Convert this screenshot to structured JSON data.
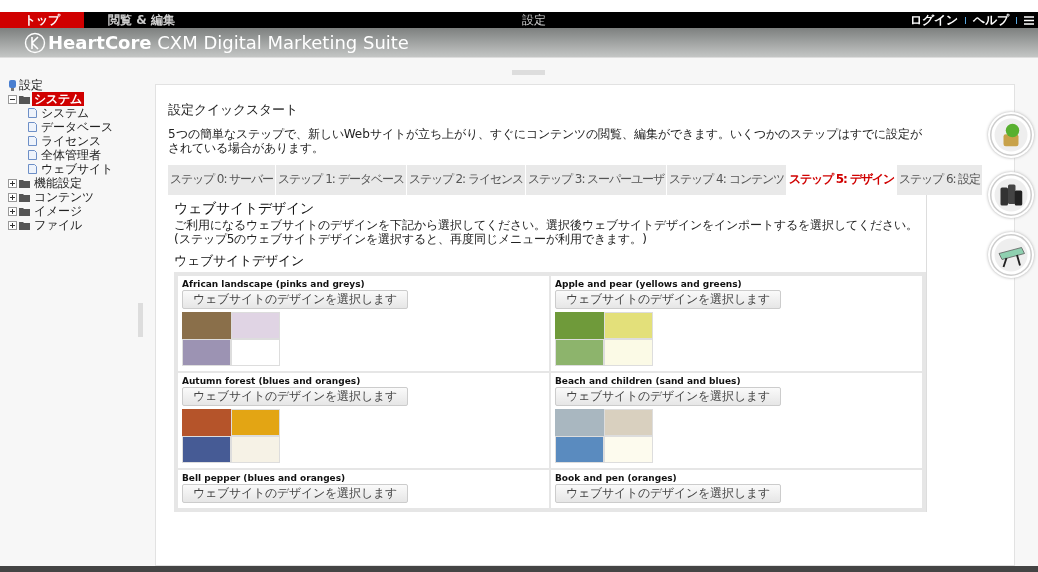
{
  "top_nav": {
    "items": [
      {
        "label": "トップ",
        "selected": true
      },
      {
        "label": "閲覧 & 編集",
        "selected": false
      }
    ],
    "center_title": "設定",
    "links": [
      "ログイン",
      "ヘルプ"
    ]
  },
  "header": {
    "brand_bold": "HeartCore",
    "brand_rest": "CXM Digital Marketing Suite"
  },
  "tree": {
    "label": "設定",
    "children": [
      {
        "label": "システム",
        "expanded": true,
        "selected": true,
        "children": [
          {
            "label": "システム"
          },
          {
            "label": "データベース"
          },
          {
            "label": "ライセンス"
          },
          {
            "label": "全体管理者"
          },
          {
            "label": "ウェブサイト"
          }
        ]
      },
      {
        "label": "機能設定",
        "expanded": false,
        "selected": false
      },
      {
        "label": "コンテンツ",
        "expanded": false,
        "selected": false
      },
      {
        "label": "イメージ",
        "expanded": false,
        "selected": false
      },
      {
        "label": "ファイル",
        "expanded": false,
        "selected": false
      }
    ]
  },
  "page": {
    "title": "設定クイックスタート",
    "intro": "5つの簡単なステップで、新しいWebサイトが立ち上がり、すぐにコンテンツの閲覧、編集ができます。いくつかのステップはすでに設定がされている場合があります。"
  },
  "tabs": [
    {
      "label": "ステップ 0: サーバー",
      "selected": false
    },
    {
      "label": "ステップ 1: データベース",
      "selected": false
    },
    {
      "label": "ステップ 2: ライセンス",
      "selected": false
    },
    {
      "label": "ステップ 3: スーパーユーザ",
      "selected": false
    },
    {
      "label": "ステップ 4: コンテンツ",
      "selected": false
    },
    {
      "label": "ステップ 5: デザイン",
      "selected": true
    },
    {
      "label": "ステップ 6: 設定",
      "selected": false
    }
  ],
  "design_section": {
    "title": "ウェブサイトデザイン",
    "description": "ご利用になるウェブサイトのデザインを下記から選択してください。選択後ウェブサイトデザインをインポートするを選択してください。(ステップ5のウェブサイトデザインを選択すると、再度同じメニューが利用できます。)",
    "list_title": "ウェブサイトデザイン"
  },
  "designs": [
    {
      "name": "African landscape (pinks and greys)",
      "button": "ウェブサイトのデザインを選択します",
      "swatches": [
        {
          "color": "#e0d4e4"
        },
        {
          "color": "#9c93b3"
        },
        {
          "color": "#ffffff"
        }
      ]
    },
    {
      "name": "Apple and pear (yellows and greens)",
      "button": "ウェブサイトのデザインを選択します",
      "swatches": [
        {
          "color": "#e3e07a"
        },
        {
          "color": "#8db46c"
        },
        {
          "color": "#fbfae6"
        }
      ]
    },
    {
      "name": "Autumn forest (blues and oranges)",
      "button": "ウェブサイトのデザインを選択します",
      "swatches": [
        {
          "color": "#e3a514"
        },
        {
          "color": "#465b95"
        },
        {
          "color": "#f6f2e6"
        }
      ]
    },
    {
      "name": "Beach and children (sand and blues)",
      "button": "ウェブサイトのデザインを選択します",
      "swatches": [
        {
          "color": "#d9d0bf"
        },
        {
          "color": "#5a8bbf"
        },
        {
          "color": "#fdfbee"
        }
      ]
    },
    {
      "name": "Bell pepper (blues and oranges)",
      "button": "ウェブサイトのデザインを選択します"
    },
    {
      "name": "Book and pen (oranges)",
      "button": "ウェブサイトのデザインを選択します"
    }
  ]
}
